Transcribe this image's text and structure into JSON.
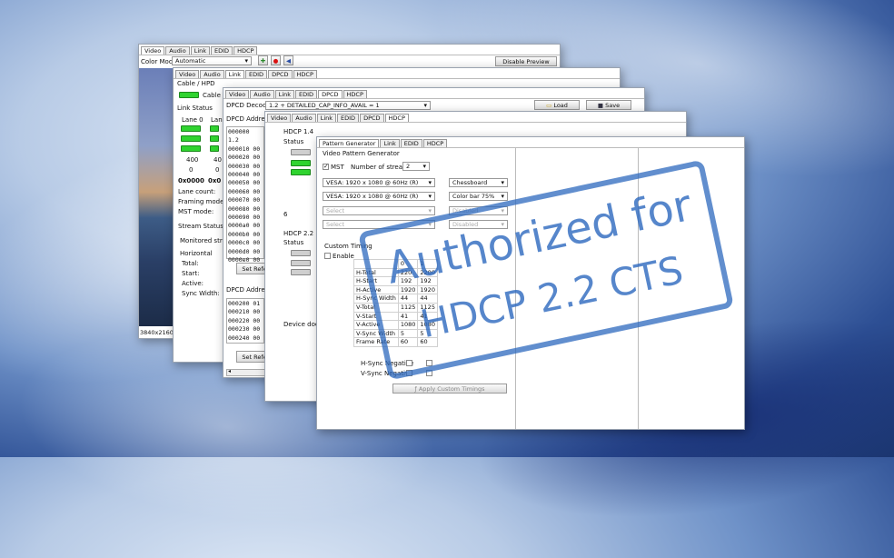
{
  "tabs": [
    "Video",
    "Audio",
    "Link",
    "EDID",
    "HDCP"
  ],
  "tabs_dpcd": [
    "Video",
    "Audio",
    "Link",
    "EDID",
    "DPCD",
    "HDCP"
  ],
  "tabs_pg": [
    "Pattern Generator",
    "Link",
    "EDID",
    "HDCP"
  ],
  "w1": {
    "color_mode_label": "Color Mode",
    "color_mode_value": "Automatic",
    "disable_preview": "Disable Preview",
    "resolution": "3840x2160p"
  },
  "w2": {
    "cable_hpd": "Cable / HPD",
    "cable": "Cable",
    "link_status": "Link Status",
    "lane0": "Lane 0",
    "lane": "Lane",
    "v1": "400",
    "v2": "40",
    "z1": "0",
    "z2": "0",
    "hex1": "0x0000",
    "hex2": "0x0",
    "lane_count": "Lane count:",
    "framing_mode": "Framing mode:",
    "mst_mode": "MST mode:",
    "stream_status": "Stream Status",
    "monitored_stream": "Monitored strea",
    "horizontal": "Horizontal",
    "total": "Total:",
    "start": "Start:",
    "active": "Active:",
    "sync_width": "Sync Width:"
  },
  "w3": {
    "dpcd_decoder_label": "DPCD Decoder",
    "dpcd_decoder_value": "1.2 + DETAILED_CAP_INFO_AVAIL = 1",
    "load": "Load",
    "save": "Save",
    "dpcd_address": "DPCD Address",
    "hex_rows": [
      "000000 1.2",
      "000010 00",
      "000020 00",
      "000030 00",
      "000040 00",
      "000050 00",
      "000060 00",
      "000070 00",
      "000080 00",
      "000090 00",
      "0000a0 00",
      "0000b0 00",
      "0000c0 00",
      "0000d0 00",
      "0000e0 00"
    ],
    "set_refe": "Set Refe",
    "dpcd_address2": "DPCD Address",
    "hex_rows2": [
      "000200 01",
      "000210 00",
      "000220 00",
      "000230 00",
      "000240 00"
    ],
    "set_refe2": "Set Refe"
  },
  "w4": {
    "hdcp14": "HDCP 1.4",
    "status": "Status",
    "six": "6",
    "hdcp22": "HDCP 2.2",
    "status2": "Status",
    "device_does": "Device does r"
  },
  "w5": {
    "video_pattern_generator": "Video Pattern Generator",
    "mst": "MST",
    "number_of_streams": "Number of streams",
    "streams_value": "2",
    "res1": "VESA: 1920 x 1080 @ 60Hz (R)",
    "res2": "VESA: 1920 x 1080 @ 60Hz (R)",
    "select1": "Select",
    "select2": "Select",
    "pattern1": "Chessboard",
    "pattern2": "Color bar 75%",
    "disabled1": "Disabled",
    "disabled2": "Disabled",
    "custom_timing": "Custom Timing",
    "enable": "Enable",
    "timing_rows": [
      [
        "",
        "0",
        "1"
      ],
      [
        "H-Total",
        "220",
        "2200"
      ],
      [
        "H-Start",
        "192",
        "192"
      ],
      [
        "H-Active",
        "1920",
        "1920"
      ],
      [
        "H-Sync Width",
        "44",
        "44"
      ],
      [
        "V-Total",
        "1125",
        "1125"
      ],
      [
        "V-Start",
        "41",
        "41"
      ],
      [
        "V-Active",
        "1080",
        "1080"
      ],
      [
        "V-Sync Width",
        "5",
        "5"
      ],
      [
        "Frame Rate",
        "60",
        "60"
      ]
    ],
    "hsync_negative": "H-Sync Negative",
    "vsync_negative": "V-Sync Negative",
    "apply_custom_timings": "Apply Custom Timings"
  },
  "stamp": {
    "line1": "Authorized for",
    "line2": "HDCP 2.2 CTS"
  }
}
